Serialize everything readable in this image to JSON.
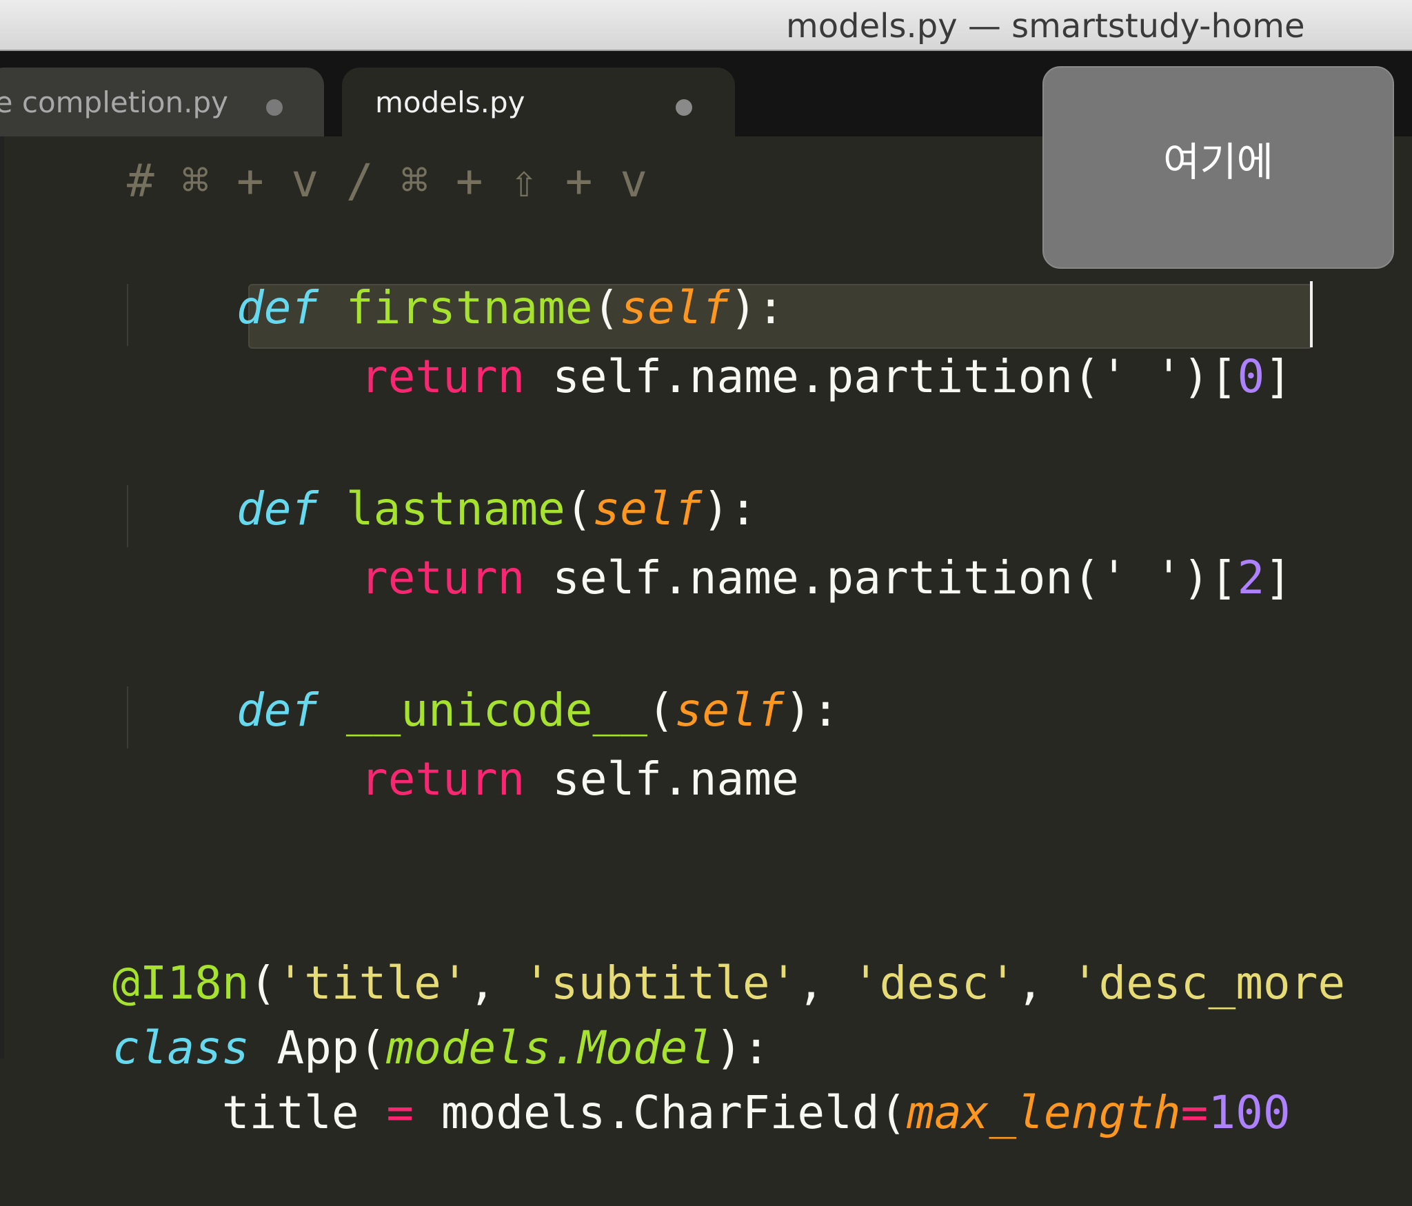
{
  "window": {
    "title": "models.py — smartstudy-home"
  },
  "tabs": [
    {
      "label": "de completion.py",
      "active": false
    },
    {
      "label": "models.py",
      "active": true
    }
  ],
  "code": {
    "comment": "# ⌘ + v / ⌘ + ⇧ + v",
    "def_kw": "def",
    "return_kw": "return",
    "self_param": "self",
    "fn_firstname": "firstname",
    "fn_lastname": "lastname",
    "fn_unicode": "__unicode__",
    "ret1_body": " self.name.partition(' ')[",
    "ret1_index": "0",
    "ret2_body": " self.name.partition(' ')[",
    "ret2_index": "2",
    "ret3_body": " self.name",
    "decorator_name": "@I18n",
    "str_title": "'title'",
    "str_subtitle": "'subtitle'",
    "str_desc": "'desc'",
    "str_desc_more": "'desc_more",
    "class_kw": "class",
    "class_name": " App(",
    "class_base": "models.Model",
    "field_line_start": "    title ",
    "field_eq": "=",
    "field_call": " models.CharField(",
    "field_kwarg": "max_length",
    "field_kwarg_eq": "=",
    "field_value": "100"
  },
  "tooltip": {
    "text": "여기에"
  },
  "colors": {
    "background": "#272822",
    "keyword": "#66d9ef",
    "return": "#f92672",
    "function": "#a6e22e",
    "param": "#fd971f",
    "string": "#e6db74",
    "number": "#ae81ff",
    "comment": "#75715e"
  }
}
